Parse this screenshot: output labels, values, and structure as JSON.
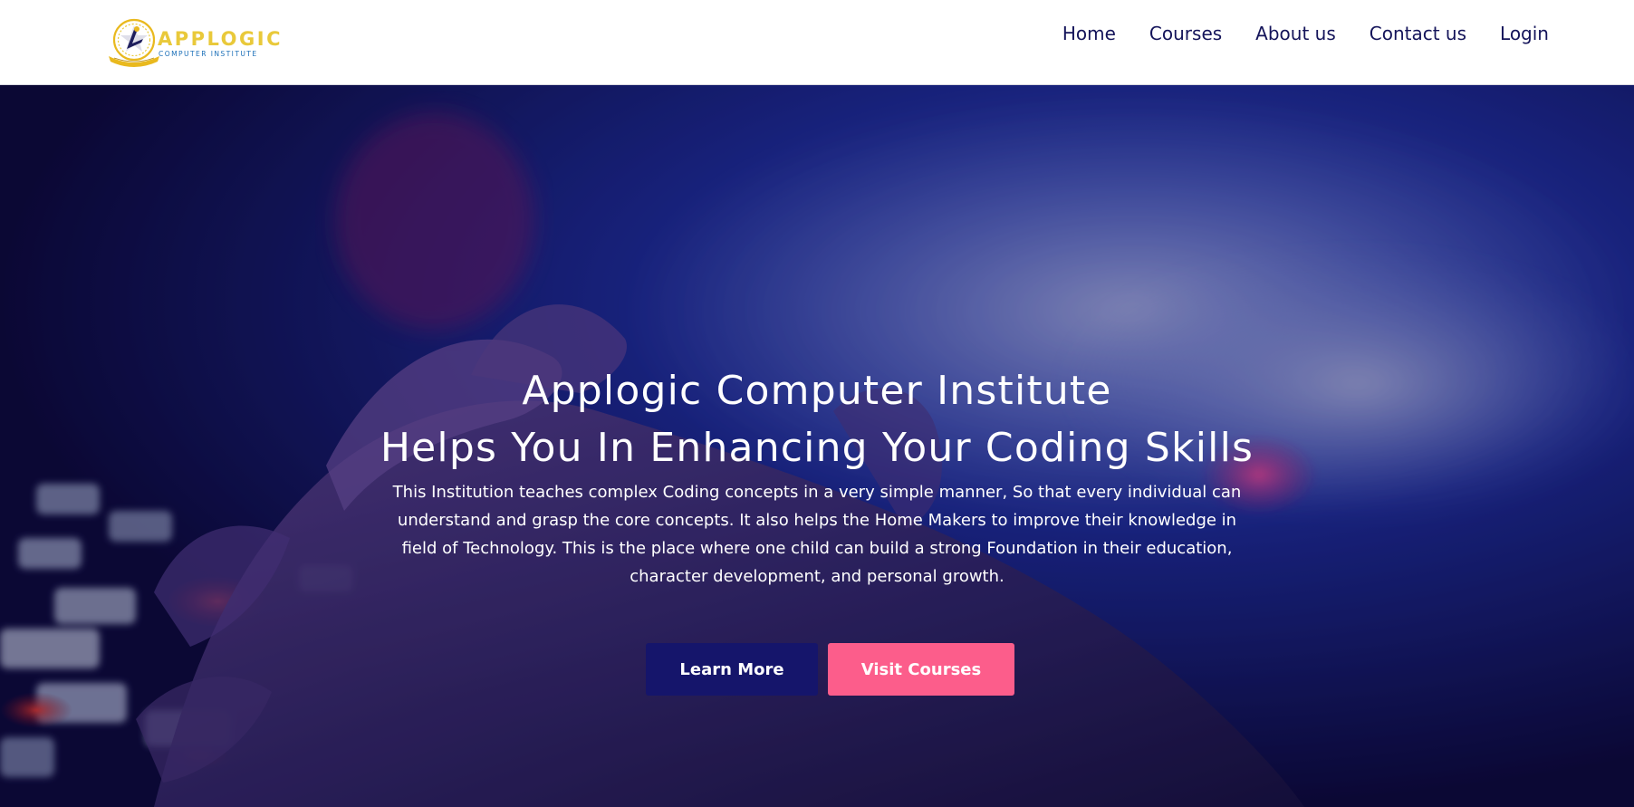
{
  "brand": {
    "name": "APPLOGIC",
    "tagline": "COMPUTER INSTITUTE",
    "logo_icon": "star-emblem-icon",
    "gold_color": "#e9c93a",
    "blue_color": "#1b6fb8"
  },
  "nav": {
    "items": [
      {
        "label": "Home"
      },
      {
        "label": "Courses"
      },
      {
        "label": "About us"
      },
      {
        "label": "Contact us"
      },
      {
        "label": "Login"
      }
    ],
    "text_color": "#14145a"
  },
  "hero": {
    "title_line1": "Applogic Computer Institute",
    "title_line2": "Helps You In Enhancing Your Coding Skills",
    "description": "This Institution teaches complex Coding concepts in a very simple manner, So that every individual can understand and grasp the core concepts. It also helps the Home Makers to improve their knowledge in field of Technology. This is the place where one child can build a strong Foundation in their education, character development, and personal growth.",
    "buttons": {
      "learn_more": "Learn More",
      "visit_courses": "Visit Courses"
    },
    "background": "keyboard-hands-photo",
    "colors": {
      "primary_button": "#15156b",
      "secondary_button": "#fc5d8b"
    }
  }
}
